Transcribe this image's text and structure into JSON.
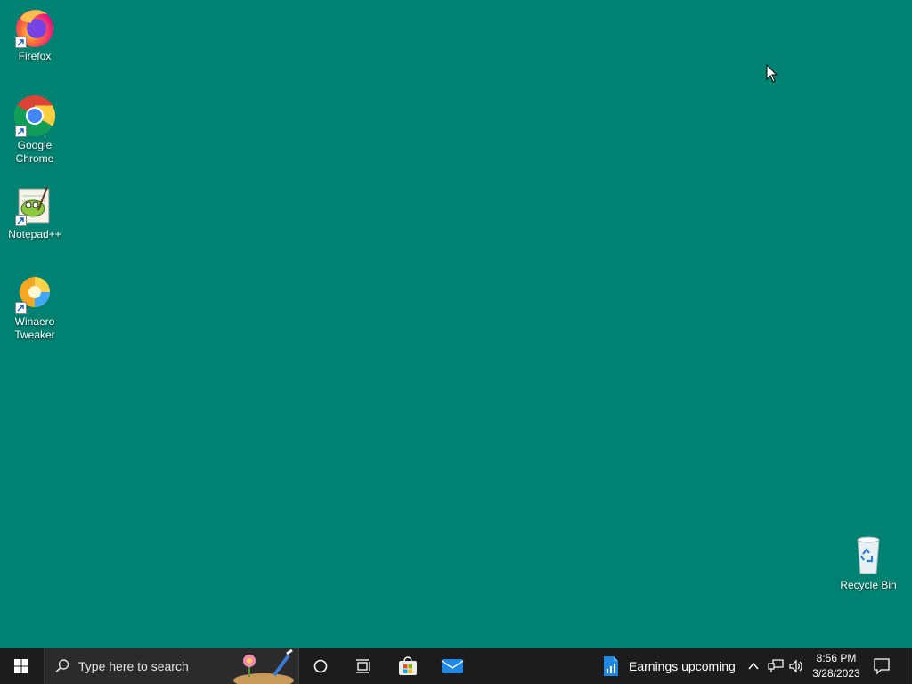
{
  "desktop": {
    "background": "#008272",
    "icons": [
      {
        "label": "Firefox"
      },
      {
        "label": "Google\nChrome"
      },
      {
        "label": "Notepad++"
      },
      {
        "label": "Winaero\nTweaker"
      },
      {
        "label": "Recycle Bin"
      }
    ]
  },
  "taskbar": {
    "search_placeholder": "Type here to search",
    "news_widget": "Earnings upcoming",
    "time": "8:56 PM",
    "date": "3/28/2023"
  }
}
